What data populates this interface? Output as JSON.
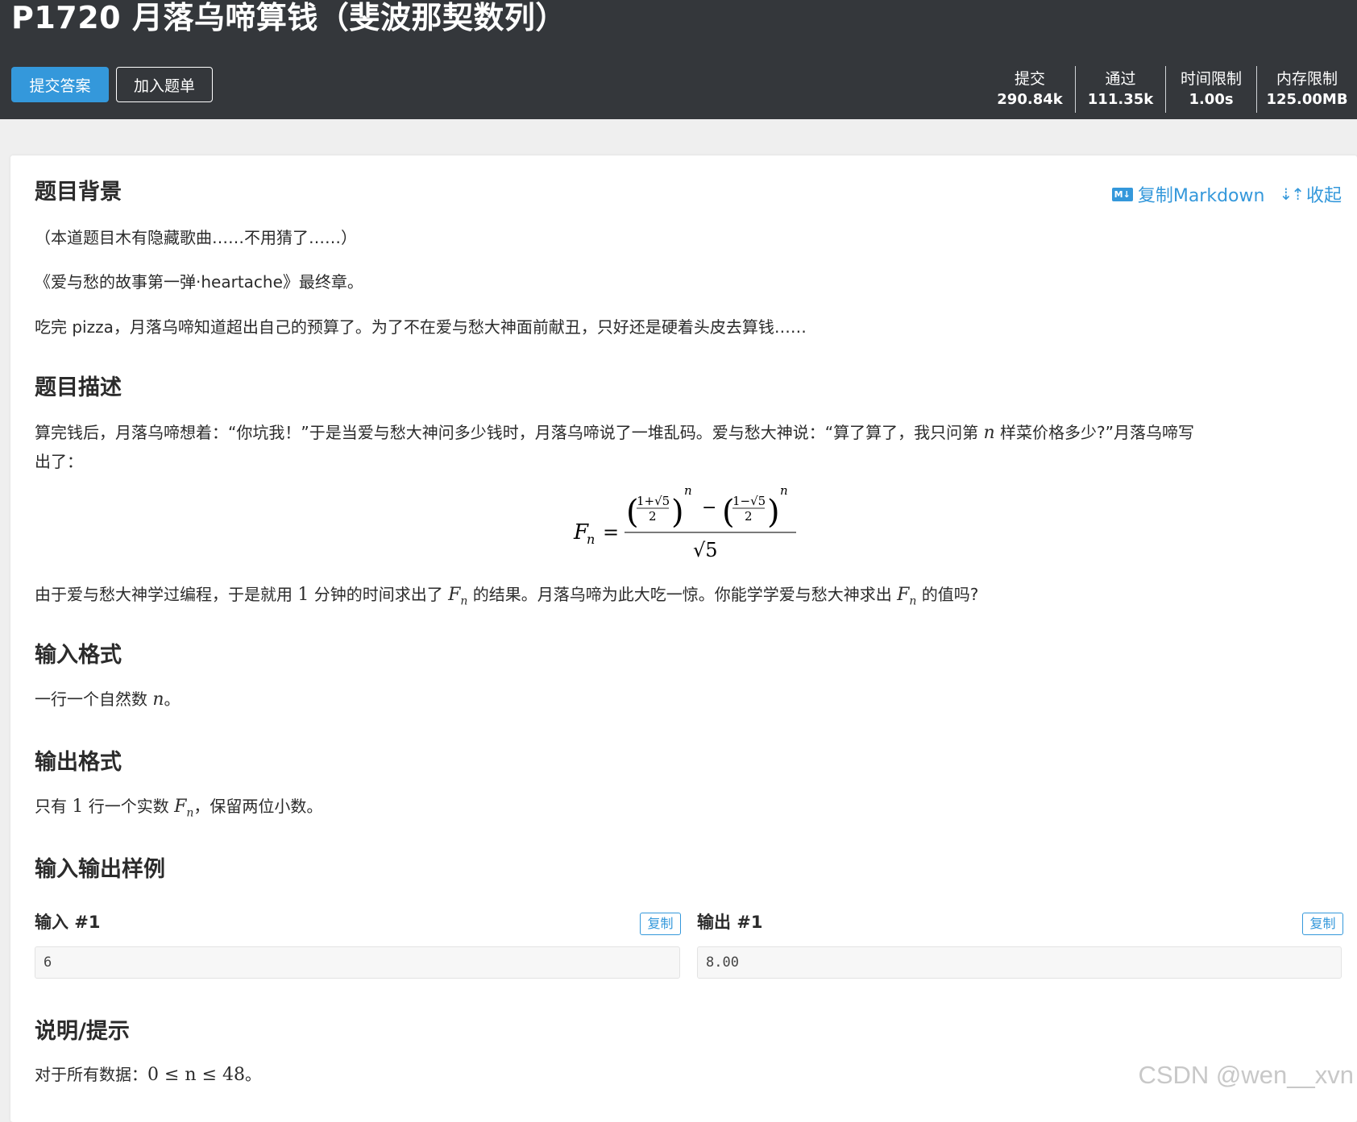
{
  "header": {
    "title": "P1720 月落乌啼算钱（斐波那契数列）",
    "submit_label": "提交答案",
    "add_list_label": "加入题单",
    "stats": [
      {
        "label": "提交",
        "value": "290.84k"
      },
      {
        "label": "通过",
        "value": "111.35k"
      },
      {
        "label": "时间限制",
        "value": "1.00s"
      },
      {
        "label": "内存限制",
        "value": "125.00MB"
      }
    ]
  },
  "toolbar": {
    "md_badge": "M↓",
    "copy_markdown": "复制Markdown",
    "collapse": "收起"
  },
  "background": {
    "heading": "题目背景",
    "p1": "（本道题目木有隐藏歌曲……不用猜了……）",
    "p2": "《爱与愁的故事第一弹·heartache》最终章。",
    "p3": "吃完 pizza，月落乌啼知道超出自己的预算了。为了不在爱与愁大神面前献丑，只好还是硬着头皮去算钱……"
  },
  "description": {
    "heading": "题目描述",
    "p1_a": "算完钱后，月落乌啼想着：“你坑我！”于是当爱与愁大神问多少钱时，月落乌啼说了一堆乱码。爱与愁大神说：“算了算了，我只问第",
    "p1_var": "n",
    "p1_b": "样菜价格多少?”月落乌啼写",
    "p1_c": "出了：",
    "p2_a": "由于爱与愁大神学过编程，于是就用",
    "p2_num": "1",
    "p2_b": "分钟的时间求出了",
    "p2_c": "的结果。月落乌啼为此大吃一惊。你能学学爱与愁大神求出",
    "p2_d": "的值吗?"
  },
  "input_format": {
    "heading": "输入格式",
    "text": "一行一个自然数",
    "var": "n",
    "end": "。"
  },
  "output_format": {
    "heading": "输出格式",
    "text_a": "只有",
    "num": "1",
    "text_b": "行一个实数",
    "text_c": "，保留两位小数。"
  },
  "samples": {
    "heading": "输入输出样例",
    "input_label": "输入 #1",
    "output_label": "输出 #1",
    "copy_label": "复制",
    "input_value": "6",
    "output_value": "8.00"
  },
  "hint": {
    "heading": "说明/提示",
    "text": "对于所有数据：",
    "constraint": "0 ≤ n ≤ 48",
    "end": "。"
  },
  "watermark": "CSDN @wen__xvn"
}
